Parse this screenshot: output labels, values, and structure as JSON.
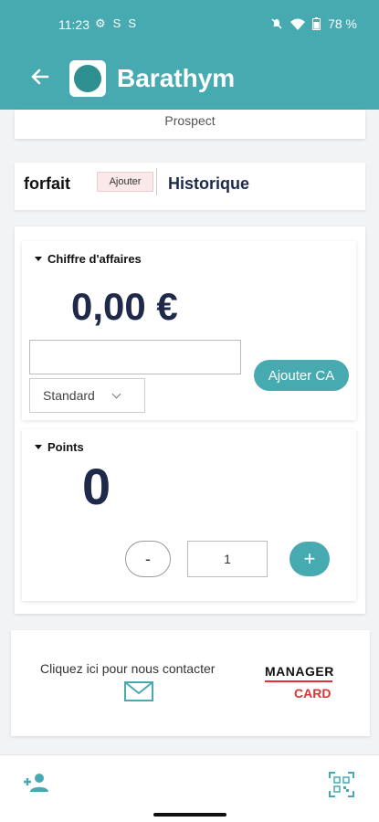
{
  "status_bar": {
    "time": "11:23",
    "battery": "78 %",
    "left_icons": [
      "gear-icon",
      "s-icon",
      "s-icon"
    ],
    "right_icons": [
      "mute-icon",
      "wifi-icon",
      "battery-icon"
    ]
  },
  "app_bar": {
    "title": "Barathym",
    "back_icon": "arrow-left-icon",
    "accent_color": "#46aab0"
  },
  "profile": {
    "status": "Prospect"
  },
  "tabs": {
    "forfait_label": "forfait",
    "add_label": "Ajouter",
    "history_label": "Historique"
  },
  "revenue": {
    "section_title": "Chiffre d'affaires",
    "amount": "0,00 €",
    "input_value": "",
    "select_value": "Standard",
    "add_button": "Ajouter CA"
  },
  "points": {
    "section_title": "Points",
    "value": "0",
    "minus_label": "-",
    "quantity": "1",
    "plus_label": "+"
  },
  "contact": {
    "text": "Cliquez ici pour nous contacter",
    "brand_top": "MANAGER",
    "brand_bottom": "CARD",
    "brand_color": "#d33333"
  },
  "bottom_bar": {
    "left_icon": "add-user-icon",
    "right_icon": "qr-scan-icon"
  }
}
